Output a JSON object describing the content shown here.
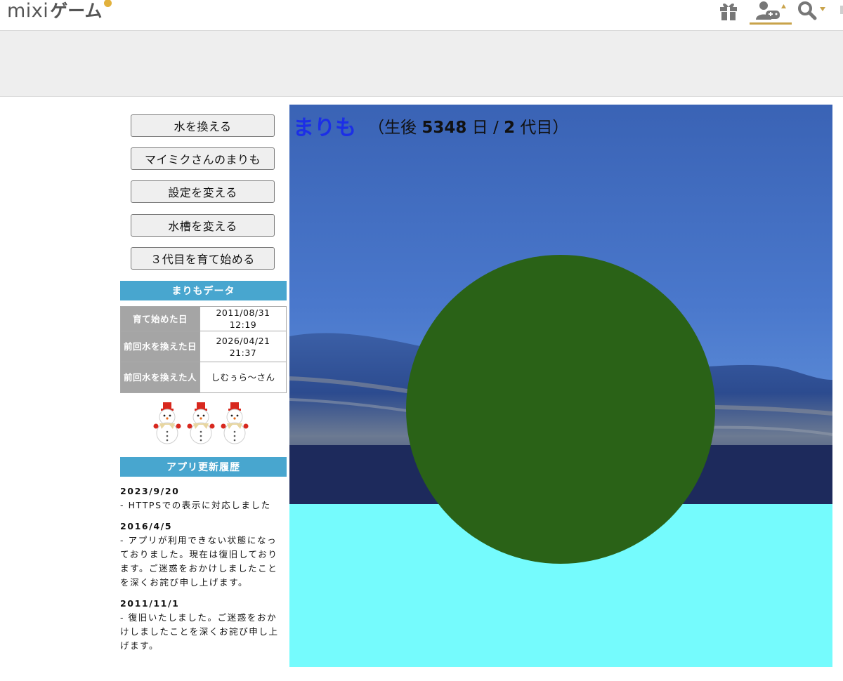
{
  "header": {
    "logo_mixi": "mixi",
    "logo_game": "ゲーム",
    "icons": [
      "gift-icon",
      "game-user-icon",
      "search-icon"
    ],
    "accent_color": "#c9a34a"
  },
  "sidebar": {
    "buttons": [
      {
        "label": "水を換える"
      },
      {
        "label": "マイミクさんのまりも"
      },
      {
        "label": "設定を変える"
      },
      {
        "label": "水槽を変える"
      },
      {
        "label": "３代目を育て始める"
      }
    ],
    "data_section": {
      "title": "まりもデータ",
      "rows": [
        {
          "label": "育て始めた日",
          "value": "2011/08/31\n12:19"
        },
        {
          "label": "前回水を換えた日",
          "value": "2026/04/21\n21:37"
        },
        {
          "label": "前回水を換えた人",
          "value": "しむぅら〜さん"
        }
      ]
    },
    "snowmen_count": 3,
    "history_section": {
      "title": "アプリ更新履歴",
      "entries": [
        {
          "date": "2023/9/20",
          "text": "- HTTPSでの表示に対応しました"
        },
        {
          "date": "2016/4/5",
          "text": "- アプリが利用できない状態になっておりました。現在は復旧しております。ご迷惑をおかけしましたことを深くお詫び申し上げます。"
        },
        {
          "date": "2011/11/1",
          "text": "- 復旧いたしました。ご迷惑をおかけしましたことを深くお詫び申し上げます。"
        }
      ]
    },
    "colors": {
      "section_header": "#48a6cf",
      "table_label_bg": "#a5a5a5"
    }
  },
  "main": {
    "marimo_name": "まりも",
    "info_open": "（生後 ",
    "age_days": "5348",
    "info_mid": " 日 / ",
    "generation": "2",
    "info_close": " 代目）",
    "colors": {
      "marimo": "#2a6217",
      "water": "#75fbfd",
      "sky": "#3f6dc0",
      "name": "#1c2fe6"
    }
  }
}
